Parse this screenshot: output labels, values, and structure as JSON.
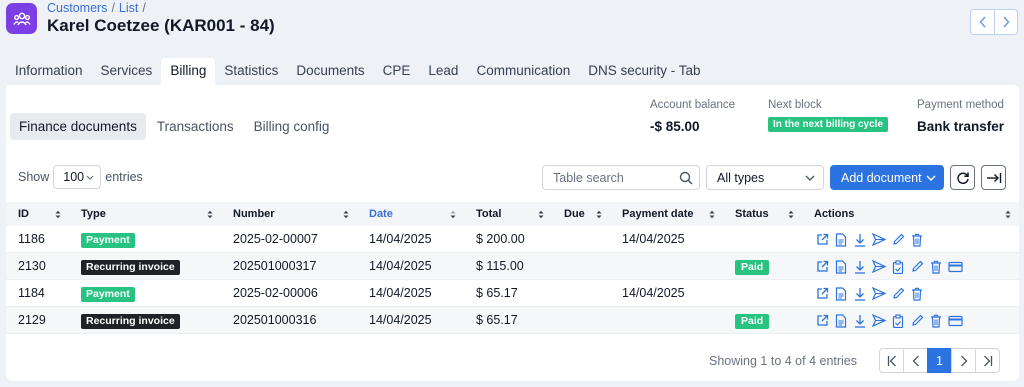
{
  "header": {
    "breadcrumb": [
      "Customers",
      "List"
    ],
    "title": "Karel Coetzee (KAR001 - 84)"
  },
  "tabs": [
    "Information",
    "Services",
    "Billing",
    "Statistics",
    "Documents",
    "CPE",
    "Lead",
    "Communication",
    "DNS security - Tab"
  ],
  "active_tab": "Billing",
  "subtabs": [
    "Finance documents",
    "Transactions",
    "Billing config"
  ],
  "active_subtab": "Finance documents",
  "summary": {
    "account_balance_label": "Account balance",
    "account_balance": "-$ 85.00",
    "next_block_label": "Next block",
    "next_block": "In the next billing cycle",
    "payment_method_label": "Payment method",
    "payment_method": "Bank transfer"
  },
  "controls": {
    "show_label": "Show",
    "entries_value": "100",
    "entries_label": "entries",
    "search_placeholder": "Table search",
    "type_filter": "All types",
    "add_button": "Add document"
  },
  "table": {
    "columns": [
      "ID",
      "Type",
      "Number",
      "Date",
      "Total",
      "Due",
      "Payment date",
      "Status",
      "Actions"
    ],
    "sorted_column": "Date",
    "rows": [
      {
        "id": "1186",
        "type": "Payment",
        "number": "2025-02-00007",
        "date": "14/04/2025",
        "total": "$ 200.00",
        "due": "",
        "payment_date": "14/04/2025",
        "status": ""
      },
      {
        "id": "2130",
        "type": "Recurring invoice",
        "number": "202501000317",
        "date": "14/04/2025",
        "total": "$ 115.00",
        "due": "",
        "payment_date": "",
        "status": "Paid"
      },
      {
        "id": "1184",
        "type": "Payment",
        "number": "2025-02-00006",
        "date": "14/04/2025",
        "total": "$ 65.17",
        "due": "",
        "payment_date": "14/04/2025",
        "status": ""
      },
      {
        "id": "2129",
        "type": "Recurring invoice",
        "number": "202501000316",
        "date": "14/04/2025",
        "total": "$ 65.17",
        "due": "",
        "payment_date": "",
        "status": "Paid"
      }
    ]
  },
  "footer": {
    "info": "Showing 1 to 4 of 4 entries",
    "current_page": "1"
  },
  "colors": {
    "accent": "#2b73e0",
    "brand_icon": "#7b3fe4",
    "success": "#28c281",
    "dark_badge": "#1f2328"
  },
  "icons": {
    "payment_actions": [
      "open-external-icon",
      "pdf-icon",
      "download-icon",
      "send-icon",
      "edit-icon",
      "delete-icon"
    ],
    "invoice_actions": [
      "open-external-icon",
      "pdf-icon",
      "download-icon",
      "send-icon",
      "clipboard-icon",
      "edit-icon",
      "delete-icon",
      "credit-card-icon"
    ]
  }
}
